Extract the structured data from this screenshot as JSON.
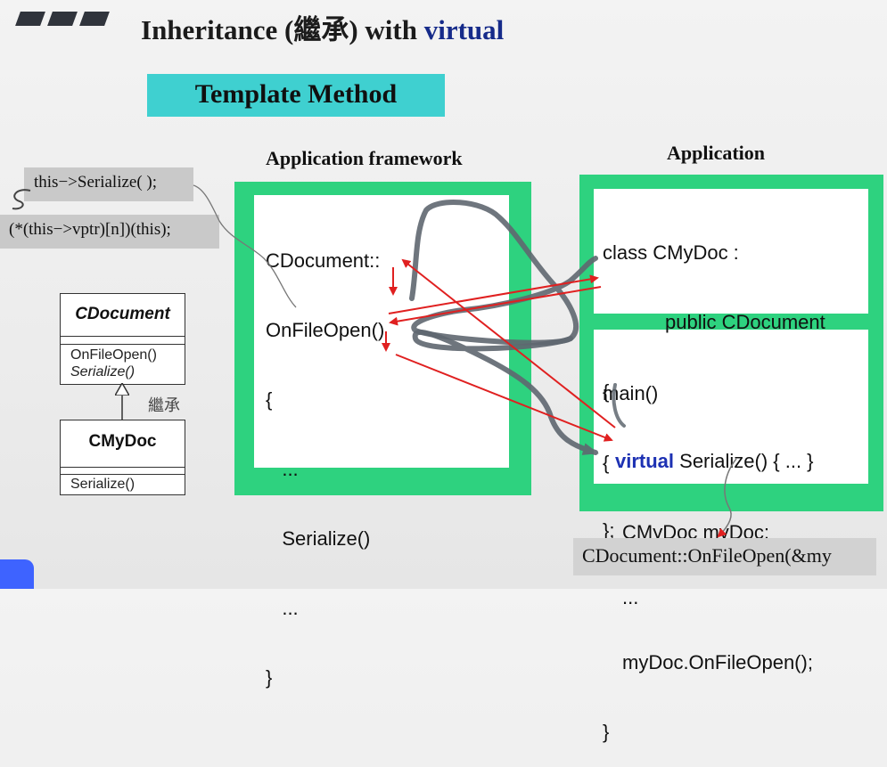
{
  "slide": {
    "title": {
      "prefix": "Inheritance (繼承) with ",
      "keyword": "virtual"
    },
    "subtitle": "Template Method",
    "framework": {
      "heading": "Application framework",
      "code": [
        "CDocument::",
        "OnFileOpen()",
        "{",
        "   ...",
        "   Serialize()",
        "   ...",
        "}"
      ]
    },
    "application": {
      "heading": "Application",
      "class_code": {
        "line1": "class CMyDoc :",
        "line2": "public CDocument",
        "line3": "{",
        "virtual_kw": "virtual",
        "line4_rest": " Serialize() { ... }",
        "line5": "};"
      },
      "main_code": [
        "main()",
        "{",
        "CMyDoc myDoc;",
        "...",
        "myDoc.OnFileOpen();",
        "}"
      ]
    },
    "annotations": {
      "this_serialize": "this−>Serialize( );",
      "vptr_call": "(*(this−>vptr)[n])(this);",
      "bottom_call": "CDocument::OnFileOpen(&my"
    },
    "uml": {
      "base_class": "CDocument",
      "base_methods": [
        "OnFileOpen()",
        "Serialize()"
      ],
      "inherit_label": "繼承",
      "derived_class": "CMyDoc",
      "derived_methods": [
        "Serialize()"
      ]
    }
  },
  "colors": {
    "box_green": "#2ed27f",
    "subtitle_teal": "#3fd0d0",
    "keyword_blue": "#162b8a",
    "arrow_red": "#e02020",
    "pen_gray": "#5f6770"
  }
}
